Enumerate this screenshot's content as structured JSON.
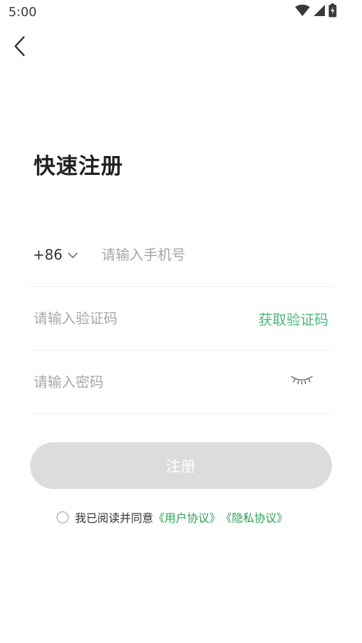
{
  "status_bar": {
    "time": "5:00",
    "icons": [
      "wifi-icon",
      "signal-icon",
      "battery-charging-icon"
    ]
  },
  "header": {
    "back_icon": "chevron-left-icon"
  },
  "title": "快速注册",
  "phone_field": {
    "country_code": "+86",
    "dropdown_icon": "chevron-down-icon",
    "placeholder": "请输入手机号",
    "value": ""
  },
  "code_field": {
    "placeholder": "请输入验证码",
    "value": "",
    "get_code_label": "获取验证码"
  },
  "password_field": {
    "placeholder": "请输入密码",
    "value": "",
    "visibility_icon": "eye-closed-icon"
  },
  "register_button": {
    "label": "注册",
    "enabled": false
  },
  "agreement": {
    "checked": false,
    "prefix": "我已阅读并同意",
    "user_agreement": "《用户协议》",
    "privacy_policy": "《隐私协议》"
  },
  "colors": {
    "accent_green": "#4fb77a",
    "link_green": "#2f9e57",
    "button_disabled": "#dcdcdc",
    "placeholder": "#a8a8a8"
  }
}
